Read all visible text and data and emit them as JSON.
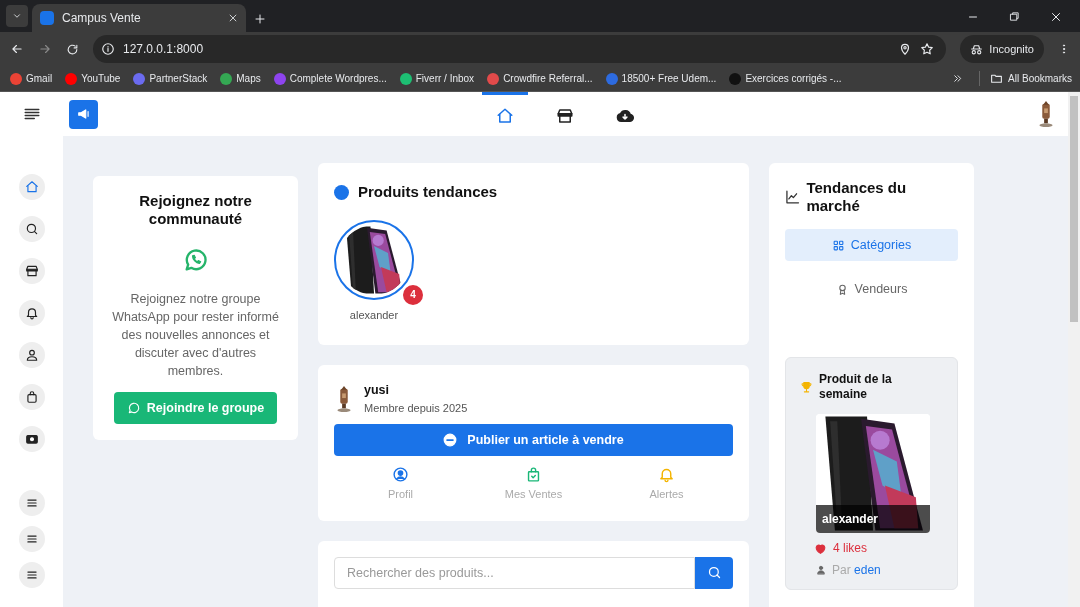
{
  "browser": {
    "tab_title": "Campus Vente",
    "url": "127.0.0.1:8000",
    "incognito_label": "Incognito",
    "bookmarks": [
      "Gmail",
      "YouTube",
      "PartnerStack",
      "Maps",
      "Complete Wordpres...",
      "Fiverr / Inbox",
      "Crowdfire Referral...",
      "18500+ Free Udem...",
      "Exercices corrigés -..."
    ],
    "all_bookmarks": "All Bookmarks"
  },
  "top_nav": [
    {
      "kind": "home",
      "selected": true
    },
    {
      "kind": "store",
      "selected": false
    },
    {
      "kind": "download",
      "selected": false
    }
  ],
  "sidebar": [
    {
      "kind": "home",
      "selected": true
    },
    {
      "kind": "search",
      "selected": false
    },
    {
      "kind": "store",
      "selected": false
    },
    {
      "kind": "bell",
      "selected": false
    },
    {
      "kind": "user",
      "selected": false
    },
    {
      "kind": "bag",
      "selected": false
    },
    {
      "kind": "cash",
      "selected": false
    },
    {
      "kind": "menu",
      "selected": false
    },
    {
      "kind": "menu",
      "selected": false
    },
    {
      "kind": "menu",
      "selected": false
    }
  ],
  "community": {
    "title": "Rejoignez notre communauté",
    "text": "Rejoignez notre groupe WhatsApp pour rester informé des nouvelles annonces et discuter avec d'autres membres.",
    "button": "Rejoindre le groupe"
  },
  "trending": {
    "title": "Produits tendances",
    "products": [
      {
        "name": "alexander",
        "badge": "4"
      }
    ]
  },
  "profile": {
    "name": "yusi",
    "since": "Membre depuis 2025",
    "publish_button": "Publier un article à vendre",
    "actions": [
      {
        "kind": "profile",
        "label": "Profil"
      },
      {
        "kind": "sales",
        "label": "Mes Ventes"
      },
      {
        "kind": "alerts",
        "label": "Alertes"
      }
    ]
  },
  "search": {
    "placeholder": "Rechercher des produits..."
  },
  "market": {
    "title": "Tendances du marché",
    "tabs": [
      {
        "kind": "grid",
        "label": "Catégories",
        "selected": true
      },
      {
        "kind": "award",
        "label": "Vendeurs",
        "selected": false
      }
    ],
    "week": {
      "title": "Produit de la semaine",
      "name": "alexander",
      "likes": "4 likes",
      "by": "Par",
      "author": "eden"
    }
  }
}
